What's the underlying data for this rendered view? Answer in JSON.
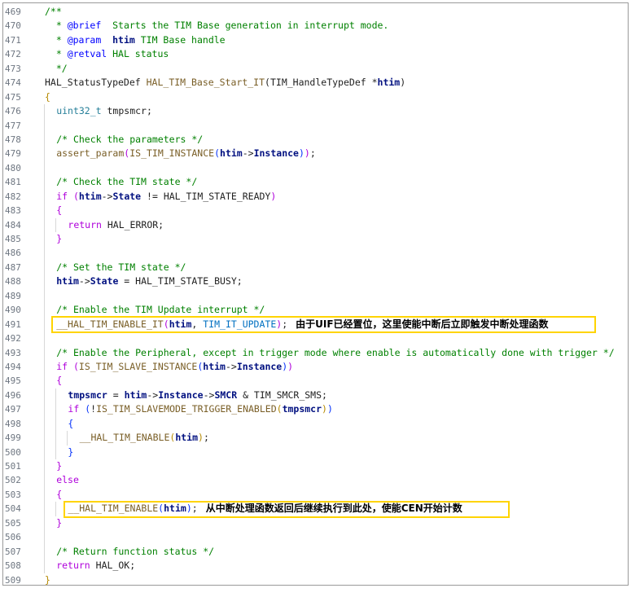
{
  "lines": [
    {
      "n": "469",
      "indent": 0,
      "code": [
        [
          "c",
          "/**"
        ]
      ]
    },
    {
      "n": "470",
      "indent": 0,
      "code": [
        [
          "c",
          "  * "
        ],
        [
          "tag",
          "@brief"
        ],
        [
          "c",
          "  Starts the TIM Base generation in interrupt mode."
        ]
      ]
    },
    {
      "n": "471",
      "indent": 0,
      "code": [
        [
          "c",
          "  * "
        ],
        [
          "tag",
          "@param"
        ],
        [
          "c",
          "  "
        ],
        [
          "var",
          "htim"
        ],
        [
          "c",
          " TIM Base handle"
        ]
      ]
    },
    {
      "n": "472",
      "indent": 0,
      "code": [
        [
          "c",
          "  * "
        ],
        [
          "tag",
          "@retval"
        ],
        [
          "c",
          " HAL status"
        ]
      ]
    },
    {
      "n": "473",
      "indent": 0,
      "code": [
        [
          "c",
          "  */"
        ]
      ]
    },
    {
      "n": "474",
      "indent": 0,
      "code": [
        [
          "p",
          "HAL_StatusTypeDef "
        ],
        [
          "fn",
          "HAL_TIM_Base_Start_IT"
        ],
        [
          "p",
          "("
        ],
        [
          "p",
          "TIM_HandleTypeDef "
        ],
        [
          "p",
          "*"
        ],
        [
          "var",
          "htim"
        ],
        [
          "p",
          ")"
        ]
      ]
    },
    {
      "n": "475",
      "indent": 0,
      "code": [
        [
          "b1",
          "{"
        ]
      ]
    },
    {
      "n": "476",
      "indent": 1,
      "code": [
        [
          "type",
          "uint32_t"
        ],
        [
          "p",
          " tmpsmcr;"
        ]
      ]
    },
    {
      "n": "477",
      "indent": 1,
      "code": []
    },
    {
      "n": "478",
      "indent": 1,
      "code": [
        [
          "c",
          "/* Check the parameters */"
        ]
      ]
    },
    {
      "n": "479",
      "indent": 1,
      "code": [
        [
          "fn",
          "assert_param"
        ],
        [
          "b2",
          "("
        ],
        [
          "fn",
          "IS_TIM_INSTANCE"
        ],
        [
          "b3",
          "("
        ],
        [
          "var",
          "htim"
        ],
        [
          "p",
          "->"
        ],
        [
          "var",
          "Instance"
        ],
        [
          "b3",
          ")"
        ],
        [
          "b2",
          ")"
        ],
        [
          "p",
          ";"
        ]
      ]
    },
    {
      "n": "480",
      "indent": 1,
      "code": []
    },
    {
      "n": "481",
      "indent": 1,
      "code": [
        [
          "c",
          "/* Check the TIM state */"
        ]
      ]
    },
    {
      "n": "482",
      "indent": 1,
      "code": [
        [
          "ctrl",
          "if"
        ],
        [
          "p",
          " "
        ],
        [
          "b2",
          "("
        ],
        [
          "var",
          "htim"
        ],
        [
          "p",
          "->"
        ],
        [
          "var",
          "State"
        ],
        [
          "p",
          " != "
        ],
        [
          "p",
          "HAL_TIM_STATE_READY"
        ],
        [
          "b2",
          ")"
        ]
      ]
    },
    {
      "n": "483",
      "indent": 1,
      "code": [
        [
          "b2",
          "{"
        ]
      ]
    },
    {
      "n": "484",
      "indent": 2,
      "code": [
        [
          "ctrl",
          "return"
        ],
        [
          "p",
          " HAL_ERROR;"
        ]
      ]
    },
    {
      "n": "485",
      "indent": 1,
      "code": [
        [
          "b2",
          "}"
        ]
      ]
    },
    {
      "n": "486",
      "indent": 1,
      "code": []
    },
    {
      "n": "487",
      "indent": 1,
      "code": [
        [
          "c",
          "/* Set the TIM state */"
        ]
      ]
    },
    {
      "n": "488",
      "indent": 1,
      "code": [
        [
          "var",
          "htim"
        ],
        [
          "p",
          "->"
        ],
        [
          "var",
          "State"
        ],
        [
          "p",
          " = HAL_TIM_STATE_BUSY;"
        ]
      ]
    },
    {
      "n": "489",
      "indent": 1,
      "code": []
    },
    {
      "n": "490",
      "indent": 1,
      "code": [
        [
          "c",
          "/* Enable the TIM Update interrupt */"
        ]
      ]
    },
    {
      "n": "491",
      "indent": 1,
      "code": [
        [
          "fn",
          "__HAL_TIM_ENABLE_IT"
        ],
        [
          "b2",
          "("
        ],
        [
          "var",
          "htim"
        ],
        [
          "p",
          ", "
        ],
        [
          "macro",
          "TIM_IT_UPDATE"
        ],
        [
          "b2",
          ")"
        ],
        [
          "p",
          ";"
        ]
      ],
      "note_key": "note1"
    },
    {
      "n": "492",
      "indent": 1,
      "code": []
    },
    {
      "n": "493",
      "indent": 1,
      "code": [
        [
          "c",
          "/* Enable the Peripheral, except in trigger mode where enable is automatically done with trigger */"
        ]
      ]
    },
    {
      "n": "494",
      "indent": 1,
      "code": [
        [
          "ctrl",
          "if"
        ],
        [
          "p",
          " "
        ],
        [
          "b2",
          "("
        ],
        [
          "fn",
          "IS_TIM_SLAVE_INSTANCE"
        ],
        [
          "b3",
          "("
        ],
        [
          "var",
          "htim"
        ],
        [
          "p",
          "->"
        ],
        [
          "var",
          "Instance"
        ],
        [
          "b3",
          ")"
        ],
        [
          "b2",
          ")"
        ]
      ]
    },
    {
      "n": "495",
      "indent": 1,
      "code": [
        [
          "b2",
          "{"
        ]
      ]
    },
    {
      "n": "496",
      "indent": 2,
      "code": [
        [
          "var",
          "tmpsmcr"
        ],
        [
          "p",
          " = "
        ],
        [
          "var",
          "htim"
        ],
        [
          "p",
          "->"
        ],
        [
          "var",
          "Instance"
        ],
        [
          "p",
          "->"
        ],
        [
          "var",
          "SMCR"
        ],
        [
          "p",
          " & TIM_SMCR_SMS;"
        ]
      ]
    },
    {
      "n": "497",
      "indent": 2,
      "code": [
        [
          "ctrl",
          "if"
        ],
        [
          "p",
          " "
        ],
        [
          "b3",
          "("
        ],
        [
          "p",
          "!"
        ],
        [
          "fn",
          "IS_TIM_SLAVEMODE_TRIGGER_ENABLED"
        ],
        [
          "b1",
          "("
        ],
        [
          "var",
          "tmpsmcr"
        ],
        [
          "b1",
          ")"
        ],
        [
          "b3",
          ")"
        ]
      ]
    },
    {
      "n": "498",
      "indent": 2,
      "code": [
        [
          "b3",
          "{"
        ]
      ]
    },
    {
      "n": "499",
      "indent": 3,
      "code": [
        [
          "fn",
          "__HAL_TIM_ENABLE"
        ],
        [
          "b1",
          "("
        ],
        [
          "var",
          "htim"
        ],
        [
          "b1",
          ")"
        ],
        [
          "p",
          ";"
        ]
      ]
    },
    {
      "n": "500",
      "indent": 2,
      "code": [
        [
          "b3",
          "}"
        ]
      ]
    },
    {
      "n": "501",
      "indent": 1,
      "code": [
        [
          "b2",
          "}"
        ]
      ]
    },
    {
      "n": "502",
      "indent": 1,
      "code": [
        [
          "ctrl",
          "else"
        ]
      ]
    },
    {
      "n": "503",
      "indent": 1,
      "code": [
        [
          "b2",
          "{"
        ]
      ]
    },
    {
      "n": "504",
      "indent": 2,
      "code": [
        [
          "fn",
          "__HAL_TIM_ENABLE"
        ],
        [
          "b3",
          "("
        ],
        [
          "var",
          "htim"
        ],
        [
          "b3",
          ")"
        ],
        [
          "p",
          ";"
        ]
      ],
      "note_key": "note2"
    },
    {
      "n": "505",
      "indent": 1,
      "code": [
        [
          "b2",
          "}"
        ]
      ]
    },
    {
      "n": "506",
      "indent": 1,
      "code": []
    },
    {
      "n": "507",
      "indent": 1,
      "code": [
        [
          "c",
          "/* Return function status */"
        ]
      ]
    },
    {
      "n": "508",
      "indent": 1,
      "code": [
        [
          "ctrl",
          "return"
        ],
        [
          "p",
          " HAL_OK;"
        ]
      ]
    },
    {
      "n": "509",
      "indent": 0,
      "code": [
        [
          "b1",
          "}"
        ]
      ]
    }
  ],
  "annotations": {
    "note1": "由于UIF已经置位，这里使能中断后立即触发中断处理函数",
    "note2": "从中断处理函数返回后继续执行到此处，使能CEN开始计数"
  },
  "colors": {
    "comment": "#008000",
    "tag": "#0000ff",
    "type": "#267f99",
    "function": "#795e26",
    "variable": "#001080",
    "control": "#af00db",
    "macro": "#0070c1",
    "highlight_box": "#ffd400"
  }
}
